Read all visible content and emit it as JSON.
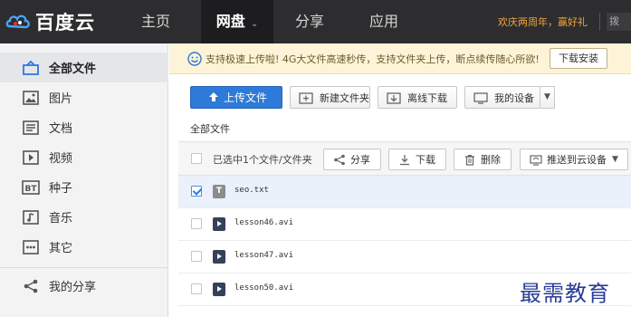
{
  "header": {
    "logo_text": "百度云",
    "nav": [
      {
        "label": "主页"
      },
      {
        "label": "网盘"
      },
      {
        "label": "分享"
      },
      {
        "label": "应用"
      }
    ],
    "nav_caret": "⌄",
    "promo_text": "欢庆两周年，赢好礼",
    "right_partial": "拨"
  },
  "sidebar": {
    "items": [
      {
        "label": "全部文件",
        "icon": "cloud-tray-icon"
      },
      {
        "label": "图片",
        "icon": "image-icon"
      },
      {
        "label": "文档",
        "icon": "document-icon"
      },
      {
        "label": "视频",
        "icon": "video-icon"
      },
      {
        "label": "种子",
        "icon": "bt-icon"
      },
      {
        "label": "音乐",
        "icon": "music-icon"
      },
      {
        "label": "其它",
        "icon": "more-icon"
      },
      {
        "label": "我的分享",
        "icon": "share-icon"
      }
    ]
  },
  "notice": {
    "text": "支持极速上传啦! 4G大文件高速秒传，支持文件夹上传，断点续传随心所欲!",
    "button": "下载安装"
  },
  "toolbar": {
    "upload": "上传文件",
    "new_folder": "新建文件夹",
    "offline_download": "离线下载",
    "my_devices": "我的设备"
  },
  "breadcrumb": "全部文件",
  "selection": {
    "text": "已选中1个文件/文件夹",
    "share": "分享",
    "download": "下载",
    "delete": "删除",
    "push": "推送到云设备"
  },
  "files": [
    {
      "name": "seo.txt",
      "type": "txt",
      "type_label": "T",
      "checked": true
    },
    {
      "name": "lesson46.avi",
      "type": "avi",
      "checked": false
    },
    {
      "name": "lesson47.avi",
      "type": "avi",
      "checked": false
    },
    {
      "name": "lesson50.avi",
      "type": "avi",
      "checked": false
    }
  ],
  "watermark": "最需教育",
  "colors": {
    "topbar": "#2d2d2f",
    "primary_button": "#2e7ad8",
    "promo": "#f0a43a",
    "notice_bg": "#fdf4d8",
    "watermark": "#2a3c97"
  }
}
